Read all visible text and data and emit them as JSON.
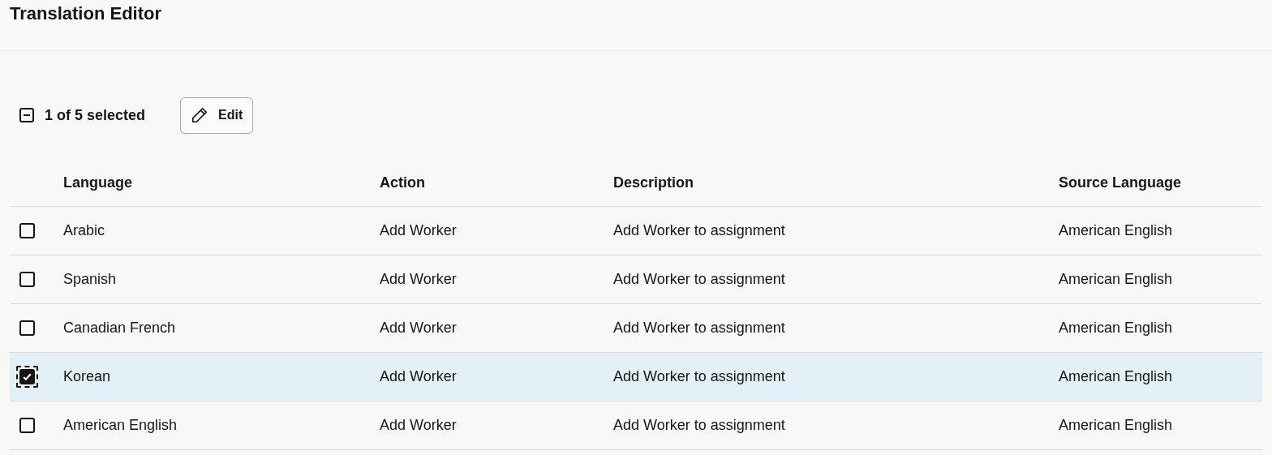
{
  "title": "Translation Editor",
  "toolbar": {
    "selection_summary": "1 of 5 selected",
    "indeterminate": true,
    "edit_button": "Edit"
  },
  "table": {
    "columns": [
      "Language",
      "Action",
      "Description",
      "Source Language"
    ],
    "rows": [
      {
        "selected": false,
        "focused": false,
        "cells": [
          "Arabic",
          "Add Worker",
          "Add Worker to assignment",
          "American English"
        ]
      },
      {
        "selected": false,
        "focused": false,
        "cells": [
          "Spanish",
          "Add Worker",
          "Add Worker to assignment",
          "American English"
        ]
      },
      {
        "selected": false,
        "focused": false,
        "cells": [
          "Canadian French",
          "Add Worker",
          "Add Worker to assignment",
          "American English"
        ]
      },
      {
        "selected": true,
        "focused": true,
        "cells": [
          "Korean",
          "Add Worker",
          "Add Worker to assignment",
          "American English"
        ]
      },
      {
        "selected": false,
        "focused": false,
        "cells": [
          "American English",
          "Add Worker",
          "Add Worker to assignment",
          "American English"
        ]
      }
    ]
  }
}
